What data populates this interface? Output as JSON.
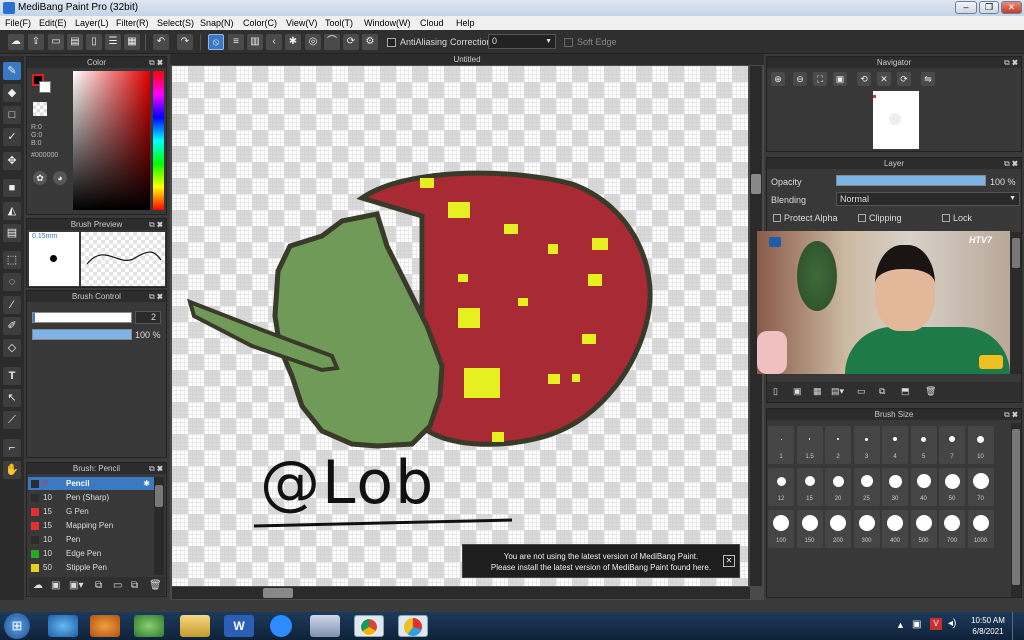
{
  "window": {
    "title": "MediBang Paint Pro (32bit)"
  },
  "menu": [
    "File(F)",
    "Edit(E)",
    "Layer(L)",
    "Filter(R)",
    "Select(S)",
    "Snap(N)",
    "Color(C)",
    "View(V)",
    "Tool(T)",
    "Window(W)",
    "Cloud",
    "Help"
  ],
  "toolbar": {
    "antialiasing": "AntiAliasing",
    "correction_label": "Correction",
    "correction_value": "0",
    "soft_edge": "Soft Edge"
  },
  "color_panel": {
    "title": "Color",
    "r": "R:0",
    "g": "G:0",
    "b": "B:0",
    "hex": "#000000"
  },
  "brush_preview": {
    "title": "Brush Preview",
    "size": "0.15mm"
  },
  "brush_control": {
    "title": "Brush Control",
    "size_value": "2",
    "opacity_value": "100 %"
  },
  "brush_list": {
    "title": "Brush: Pencil",
    "items": [
      {
        "num": "2",
        "name": "Pencil",
        "color": "#2c2c2c"
      },
      {
        "num": "10",
        "name": "Pen (Sharp)",
        "color": "#2c2c2c"
      },
      {
        "num": "15",
        "name": "G Pen",
        "color": "#e03030"
      },
      {
        "num": "15",
        "name": "Mapping Pen",
        "color": "#e03030"
      },
      {
        "num": "10",
        "name": "Pen",
        "color": "#2c2c2c"
      },
      {
        "num": "10",
        "name": "Edge Pen",
        "color": "#22aa22"
      },
      {
        "num": "50",
        "name": "Stipple Pen",
        "color": "#e8d020"
      }
    ]
  },
  "canvas": {
    "tab": "Untitled",
    "signature": "@Lob"
  },
  "navigator": {
    "title": "Navigator"
  },
  "layer_panel": {
    "title": "Layer",
    "opacity_label": "Opacity",
    "opacity_value": "100 %",
    "opacity": 1.0,
    "blending_label": "Blending",
    "blending_value": "Normal",
    "protect_alpha": "Protect Alpha",
    "clipping": "Clipping",
    "lock": "Lock"
  },
  "video_overlay": {
    "channel": "HTV7"
  },
  "brush_size": {
    "title": "Brush Size",
    "sizes": [
      "1",
      "1.5",
      "2",
      "3",
      "4",
      "5",
      "7",
      "10",
      "12",
      "15",
      "20",
      "25",
      "30",
      "40",
      "50",
      "70",
      "100",
      "150",
      "200",
      "300",
      "400",
      "500",
      "700",
      "1000"
    ]
  },
  "notification": {
    "line1": "You are not using the latest version of MediBang Paint.",
    "line2": "Please install the latest version of MediBang Paint found here."
  },
  "taskbar": {
    "time": "10:50 AM",
    "date": "6/8/2021"
  },
  "colors": {
    "accent": "#3b79c2",
    "panel": "#383838",
    "strawberry": "#a82a35",
    "leaf": "#6f9a58"
  }
}
